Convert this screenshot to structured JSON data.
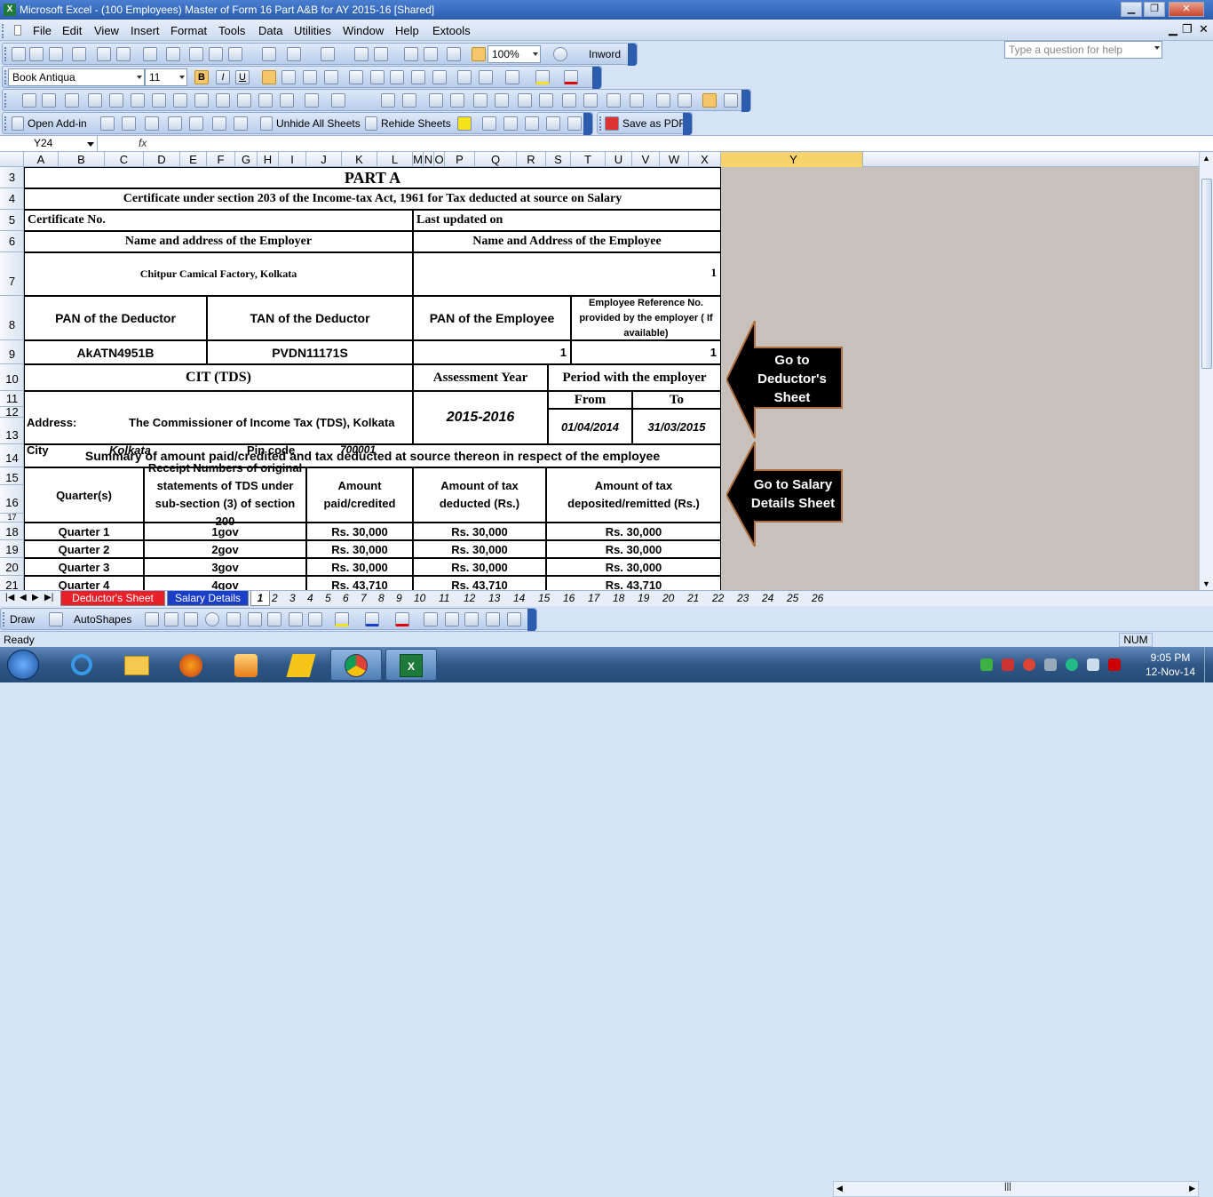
{
  "app": {
    "title": "Microsoft Excel - (100 Employees) Master of Form 16 Part A&B for AY 2015-16  [Shared]"
  },
  "menu": {
    "items": [
      "File",
      "Edit",
      "View",
      "Insert",
      "Format",
      "Tools",
      "Data",
      "Utilities",
      "Window",
      "Help",
      "Extools"
    ],
    "help_placeholder": "Type a question for help"
  },
  "toolbar": {
    "zoom": "100%",
    "inword": "Inword",
    "font": "Book Antiqua",
    "size": "11",
    "open_addin": "Open Add-in",
    "unhide": "Unhide All Sheets",
    "rehide": "Rehide Sheets",
    "save_pdf": "Save as PDF"
  },
  "formula": {
    "cell_ref": "Y24",
    "fx": "fx"
  },
  "columns": [
    "A",
    "B",
    "C",
    "D",
    "E",
    "F",
    "G",
    "H",
    "I",
    "J",
    "K",
    "L",
    "M",
    "N",
    "O",
    "P",
    "Q",
    "R",
    "S",
    "T",
    "U",
    "V",
    "W",
    "X",
    "Y"
  ],
  "rows": [
    "3",
    "4",
    "5",
    "6",
    "7",
    "8",
    "9",
    "10",
    "11",
    "12",
    "13",
    "14",
    "15",
    "16",
    "17",
    "18",
    "19",
    "20",
    "21"
  ],
  "form": {
    "part": "PART A",
    "certificate": "Certificate under section 203 of the Income-tax Act, 1961 for Tax deducted at source on Salary",
    "cert_no": "Certificate No.",
    "last_updated": "Last updated on",
    "employer_label": "Name and address of the Employer",
    "employee_label": "Name and Address of the Employee",
    "employer_value": "Chitpur Camical Factory, Kolkata",
    "employee_value": "1",
    "pan_deductor": "PAN of the Deductor",
    "tan_deductor": "TAN of the Deductor",
    "pan_employee": "PAN of the Employee",
    "emp_ref": "Employee Reference No. provided by the employer ( If available)",
    "pan_deductor_val": "AkATN4951B",
    "tan_deductor_val": "PVDN11171S",
    "pan_employee_val": "1",
    "emp_ref_val": "1",
    "cit": "CIT (TDS)",
    "assessment_year": "Assessment Year",
    "period": "Period with the employer",
    "address_label": "Address:",
    "address_value": "The Commissioner of Income Tax (TDS), Kolkata",
    "ay_value": "2015-2016",
    "from_label": "From",
    "to_label": "To",
    "city_label": "City",
    "city_value": "Kolkata",
    "pin_label": "Pin code",
    "pin_value": "700001",
    "from_value": "01/04/2014",
    "to_value": "31/03/2015",
    "summary": "Summary of amount paid/credited and tax deducted at source thereon in respect of the employee",
    "h_quarter": "Quarter(s)",
    "h_receipt": "Receipt Numbers of original statements of TDS under sub-section (3) of section 200",
    "h_amount": "Amount paid/credited",
    "h_taxded": "Amount of tax deducted (Rs.)",
    "h_taxdep": "Amount of tax deposited/remitted (Rs.)",
    "quarters": [
      {
        "q": "Quarter 1",
        "r": "1gov",
        "a": "Rs. 30,000",
        "d": "Rs. 30,000",
        "p": "Rs. 30,000"
      },
      {
        "q": "Quarter 2",
        "r": "2gov",
        "a": "Rs. 30,000",
        "d": "Rs. 30,000",
        "p": "Rs. 30,000"
      },
      {
        "q": "Quarter 3",
        "r": "3gov",
        "a": "Rs. 30,000",
        "d": "Rs. 30,000",
        "p": "Rs. 30,000"
      },
      {
        "q": "Quarter 4",
        "r": "4gov",
        "a": "Rs. 43,710",
        "d": "Rs. 43,710",
        "p": "Rs. 43,710"
      }
    ]
  },
  "arrows": {
    "deductor": "Go to Deductor's Sheet",
    "salary": "Go to Salary Details Sheet"
  },
  "tabs": {
    "deductor": "Deductor's Sheet",
    "salary": "Salary Details",
    "numbers": [
      "1",
      "2",
      "3",
      "4",
      "5",
      "6",
      "7",
      "8",
      "9",
      "10",
      "11",
      "12",
      "13",
      "14",
      "15",
      "16",
      "17",
      "18",
      "19",
      "20",
      "21",
      "22",
      "23",
      "24",
      "25",
      "26"
    ]
  },
  "draw": {
    "draw": "Draw",
    "autoshapes": "AutoShapes"
  },
  "status": {
    "ready": "Ready",
    "num": "NUM"
  },
  "clock": {
    "time": "9:05 PM",
    "date": "12-Nov-14"
  }
}
